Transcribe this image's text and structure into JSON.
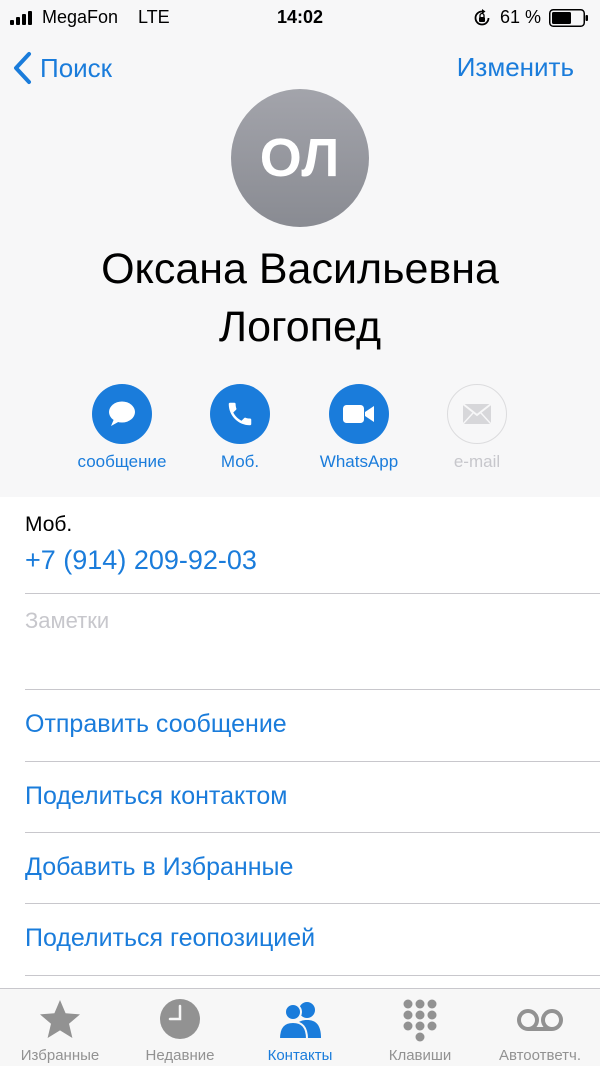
{
  "status_bar": {
    "carrier": "MegaFon",
    "network": "LTE",
    "time": "14:02",
    "battery_percent": "61 %"
  },
  "nav": {
    "back_label": "Поиск",
    "edit_label": "Изменить"
  },
  "contact": {
    "initials": "ОЛ",
    "name_line1": "Оксана Васильевна",
    "name_line2": "Логопед"
  },
  "actions": [
    {
      "label": "сообщение",
      "icon": "message-icon",
      "enabled": true
    },
    {
      "label": "Моб.",
      "icon": "phone-icon",
      "enabled": true
    },
    {
      "label": "WhatsApp",
      "icon": "video-icon",
      "enabled": true
    },
    {
      "label": "e-mail",
      "icon": "mail-icon",
      "enabled": false
    }
  ],
  "phone": {
    "label": "Моб.",
    "value": "+7 (914) 209-92-03"
  },
  "notes": {
    "placeholder": "Заметки"
  },
  "links": [
    "Отправить сообщение",
    "Поделиться контактом",
    "Добавить в Избранные",
    "Поделиться геопозицией"
  ],
  "tabs": [
    {
      "label": "Избранные",
      "icon": "star-icon",
      "active": false
    },
    {
      "label": "Недавние",
      "icon": "clock-icon",
      "active": false
    },
    {
      "label": "Контакты",
      "icon": "contacts-icon",
      "active": true
    },
    {
      "label": "Клавиши",
      "icon": "keypad-icon",
      "active": false
    },
    {
      "label": "Автоответч.",
      "icon": "voicemail-icon",
      "active": false
    }
  ],
  "colors": {
    "accent": "#1a7cdb",
    "inactive": "#929292",
    "disabled": "#c7c7cc"
  }
}
